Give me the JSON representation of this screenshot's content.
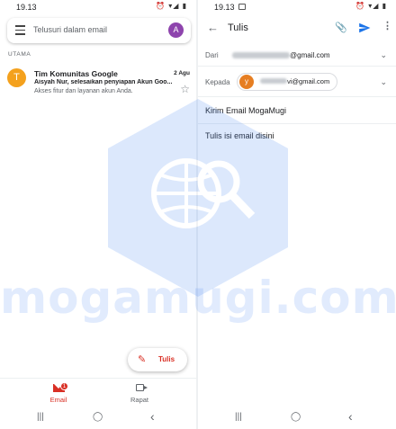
{
  "status_left": {
    "time": "19.13",
    "icons": "⏰ ▾◢ ▮"
  },
  "status_right": {
    "time": "19.13",
    "icons": "⏰ ▾◢ ▮"
  },
  "inbox": {
    "search_placeholder": "Telusuri dalam email",
    "account_initial": "A",
    "section_label": "UTAMA",
    "emails": [
      {
        "initial": "T",
        "sender": "Tim Komunitas Google",
        "date": "2 Agu",
        "subject": "Aisyah Nur, selesaikan penyiapan Akun Goo...",
        "snippet": "Akses fitur dan layanan akun Anda."
      }
    ],
    "compose_label": "Tulis",
    "nav": [
      {
        "label": "Email",
        "badge": "1"
      },
      {
        "label": "Rapat"
      }
    ]
  },
  "compose": {
    "title": "Tulis",
    "from_label": "Dari",
    "from_suffix": "@gmail.com",
    "to_label": "Kepada",
    "to_initial": "y",
    "to_suffix": "vi@gmail.com",
    "subject": "Kirim Email MogaMugi",
    "body": "Tulis isi email disini"
  },
  "watermark": {
    "text": "mogamugi.com"
  },
  "system_nav": {
    "recents": "|||",
    "home": "◯",
    "back": "‹"
  },
  "colors": {
    "accent_red": "#d93025",
    "send_blue": "#1a73e8",
    "avatar_purple": "#8e44ad",
    "avatar_orange": "#f4a11d",
    "watermark_blue": "#4285f4"
  }
}
